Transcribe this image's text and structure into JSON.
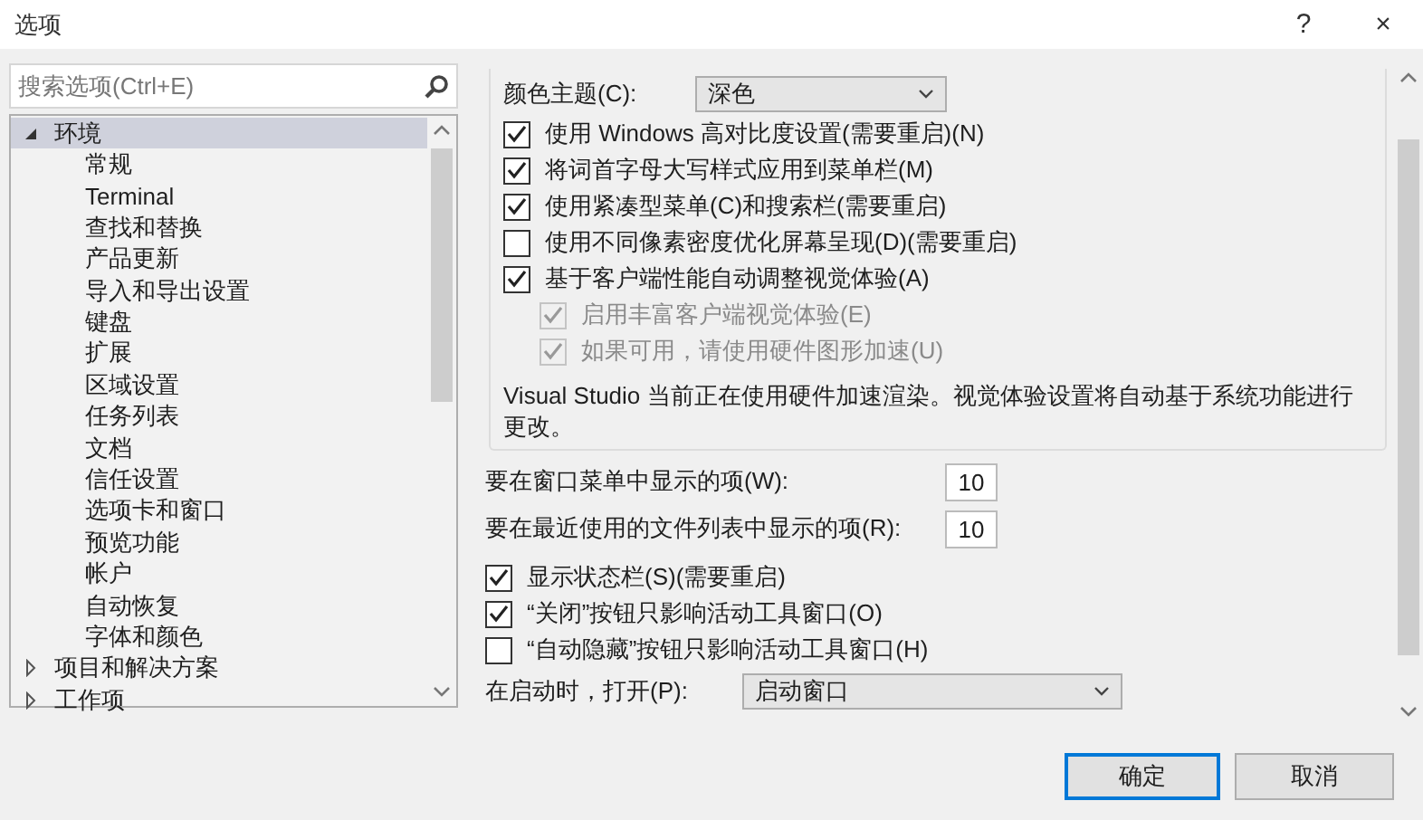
{
  "window": {
    "title": "选项",
    "help": "?",
    "close": "×"
  },
  "search": {
    "placeholder": "搜索选项(Ctrl+E)"
  },
  "tree": [
    {
      "label": "环境",
      "expanded": true,
      "selected": true,
      "children": [
        {
          "label": "常规",
          "selected": false
        },
        {
          "label": "Terminal",
          "selected": false
        },
        {
          "label": "查找和替换",
          "selected": false
        },
        {
          "label": "产品更新",
          "selected": false
        },
        {
          "label": "导入和导出设置",
          "selected": false
        },
        {
          "label": "键盘",
          "selected": false
        },
        {
          "label": "扩展",
          "selected": false
        },
        {
          "label": "区域设置",
          "selected": false
        },
        {
          "label": "任务列表",
          "selected": false
        },
        {
          "label": "文档",
          "selected": false
        },
        {
          "label": "信任设置",
          "selected": false
        },
        {
          "label": "选项卡和窗口",
          "selected": false
        },
        {
          "label": "预览功能",
          "selected": false
        },
        {
          "label": "帐户",
          "selected": false
        },
        {
          "label": "自动恢复",
          "selected": false
        },
        {
          "label": "字体和颜色",
          "selected": false
        }
      ]
    },
    {
      "label": "项目和解决方案",
      "expanded": false,
      "selected": false
    },
    {
      "label": "工作项",
      "expanded": false,
      "selected": false
    }
  ],
  "theme": {
    "label": "颜色主题(C):",
    "value": "深色"
  },
  "visual_options": [
    {
      "label": "使用 Windows 高对比度设置(需要重启)(N)",
      "checked": true,
      "disabled": false,
      "indented": false
    },
    {
      "label": "将词首字母大写样式应用到菜单栏(M)",
      "checked": true,
      "disabled": false,
      "indented": false
    },
    {
      "label": "使用紧凑型菜单(C)和搜索栏(需要重启)",
      "checked": true,
      "disabled": false,
      "indented": false
    },
    {
      "label": "使用不同像素密度优化屏幕呈现(D)(需要重启)",
      "checked": false,
      "disabled": false,
      "indented": false
    },
    {
      "label": "基于客户端性能自动调整视觉体验(A)",
      "checked": true,
      "disabled": false,
      "indented": false
    },
    {
      "label": "启用丰富客户端视觉体验(E)",
      "checked": true,
      "disabled": true,
      "indented": true
    },
    {
      "label": "如果可用，请使用硬件图形加速(U)",
      "checked": true,
      "disabled": true,
      "indented": true
    }
  ],
  "info": "Visual Studio 当前正在使用硬件加速渲染。视觉体验设置将自动基于系统功能进行更改。",
  "counts": [
    {
      "label": "要在窗口菜单中显示的项(W):",
      "value": "10"
    },
    {
      "label": "要在最近使用的文件列表中显示的项(R):",
      "value": "10"
    }
  ],
  "options": [
    {
      "label": "显示状态栏(S)(需要重启)",
      "checked": true
    },
    {
      "label": "“关闭”按钮只影响活动工具窗口(O)",
      "checked": true
    },
    {
      "label": "“自动隐藏”按钮只影响活动工具窗口(H)",
      "checked": false
    }
  ],
  "startup": {
    "label": "在启动时，打开(P):",
    "value": "启动窗口"
  },
  "buttons": [
    {
      "label": "确定",
      "default": true
    },
    {
      "label": "取消",
      "default": false
    }
  ]
}
